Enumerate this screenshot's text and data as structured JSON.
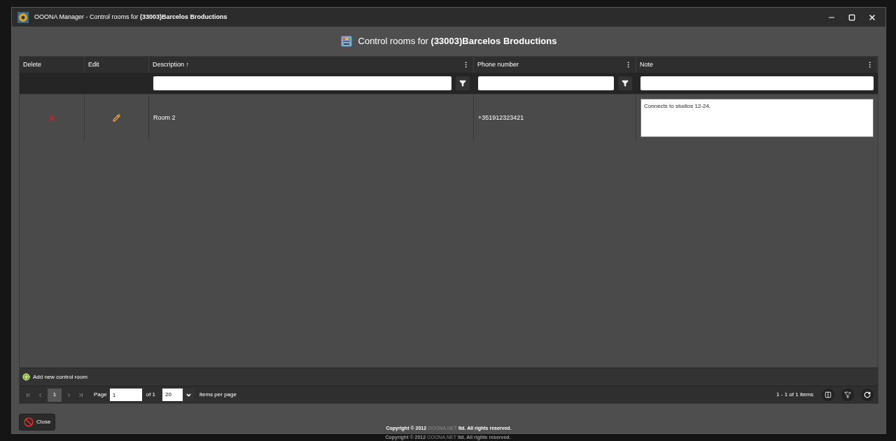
{
  "window": {
    "title_plain": "OOONA Manager - Control rooms for ",
    "title_bold": "(33003)Barcelos Broductions"
  },
  "heading": {
    "plain": "Control rooms for ",
    "bold": "(33003)Barcelos Broductions"
  },
  "table": {
    "columns": [
      {
        "label": "Delete",
        "kind": "plain"
      },
      {
        "label": "Edit",
        "kind": "plain"
      },
      {
        "label": "Description",
        "kind": "filter",
        "sort": "↑"
      },
      {
        "label": "Phone number",
        "kind": "filter"
      },
      {
        "label": "Note",
        "kind": "text"
      }
    ],
    "rows": [
      {
        "description": "Room 2",
        "phone": "+351912323421",
        "note": "Connects to studios 12-24."
      }
    ]
  },
  "add_button": "Add new control room",
  "pager": {
    "pages": [
      {
        "label": "1",
        "selected": true
      }
    ],
    "page_label": "Page",
    "page_value": "1",
    "of": "of 1",
    "page_size": "20",
    "per_page": "items per page",
    "summary": "1 - 1 of 1 items"
  },
  "close_button": "Close",
  "copyright": [
    {
      "before": "Copyright © 2012 ",
      "brand": "OOONA.NET",
      "after": " ltd. All rights reserved."
    },
    {
      "before": "Copyright © 2012 ",
      "brand": "OOONA.NET",
      "after": " ltd. All rights reserved."
    }
  ]
}
